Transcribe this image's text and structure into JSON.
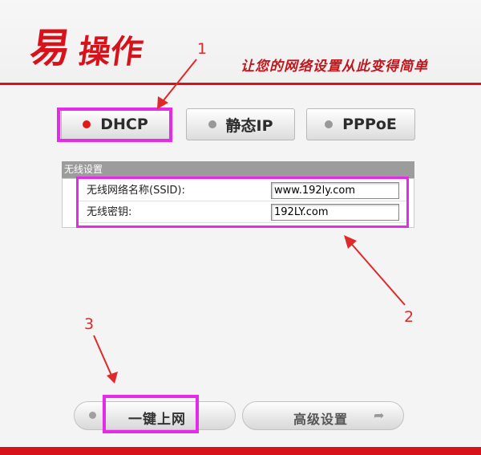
{
  "header": {
    "logo_mark": "易",
    "logo_text": "操作",
    "slogan": "让您的网络设置从此变得简单"
  },
  "modes": [
    {
      "label": "DHCP",
      "active": true
    },
    {
      "label": "静态IP",
      "active": false
    },
    {
      "label": "PPPoE",
      "active": false
    }
  ],
  "wireless": {
    "title": "无线设置",
    "ssid_label": "无线网络名称(SSID):",
    "ssid_value": "www.192ly.com",
    "password_label": "无线密钥:",
    "password_value": "192LY.com"
  },
  "actions": {
    "connect_label": "一键上网",
    "advanced_label": "高级设置"
  },
  "annotations": {
    "step1": "1",
    "step2": "2",
    "step3": "3",
    "highlight_color": "#e42ce8",
    "arrow_color": "#e0292a"
  },
  "colors": {
    "brand_red": "#d8121b",
    "active_dot": "#e01818"
  }
}
